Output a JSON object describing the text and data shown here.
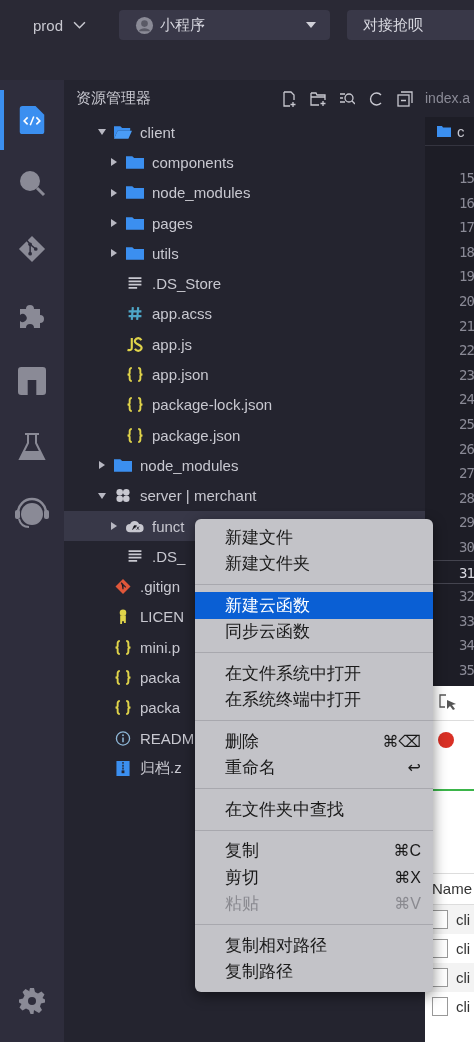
{
  "top_bar": {
    "env": "prod",
    "project": "小程序",
    "action": "对接抢呗"
  },
  "activity_bar": [
    {
      "kind": "code",
      "selected": true
    },
    {
      "kind": "search",
      "selected": false
    },
    {
      "kind": "git",
      "selected": false
    },
    {
      "kind": "extensions",
      "selected": false
    },
    {
      "kind": "store",
      "selected": false
    },
    {
      "kind": "test",
      "selected": false
    },
    {
      "kind": "support",
      "selected": false
    },
    {
      "kind": "settings",
      "selected": false
    }
  ],
  "explorer": {
    "title": "资源管理器",
    "tree": [
      {
        "name": "client",
        "kind": "folder",
        "expanded": true,
        "selected": false,
        "children": [
          {
            "name": "components",
            "kind": "folder",
            "expanded": false,
            "selected": false
          },
          {
            "name": "node_modules",
            "kind": "folder",
            "expanded": false,
            "selected": false
          },
          {
            "name": "pages",
            "kind": "folder",
            "expanded": false,
            "selected": false
          },
          {
            "name": "utils",
            "kind": "folder",
            "expanded": false,
            "selected": false
          },
          {
            "name": ".DS_Store",
            "kind": "text",
            "selected": false
          },
          {
            "name": "app.acss",
            "kind": "css",
            "selected": false
          },
          {
            "name": "app.js",
            "kind": "js",
            "selected": false
          },
          {
            "name": "app.json",
            "kind": "json",
            "selected": false
          },
          {
            "name": "package-lock.json",
            "kind": "json",
            "selected": false
          },
          {
            "name": "package.json",
            "kind": "json",
            "selected": false
          }
        ]
      },
      {
        "name": "node_modules",
        "kind": "folder",
        "expanded": false,
        "selected": false
      },
      {
        "name": "server | merchant",
        "kind": "server",
        "expanded": true,
        "selected": false,
        "children": [
          {
            "name": "funct",
            "kind": "cloud",
            "expanded": false,
            "selected": true
          },
          {
            "name": ".DS_",
            "kind": "text",
            "selected": false
          }
        ]
      },
      {
        "name": ".gitign",
        "kind": "git",
        "selected": false
      },
      {
        "name": "LICEN",
        "kind": "license",
        "selected": false
      },
      {
        "name": "mini.p",
        "kind": "json",
        "selected": false
      },
      {
        "name": "packa",
        "kind": "json",
        "selected": false
      },
      {
        "name": "packa",
        "kind": "json",
        "selected": false
      },
      {
        "name": "READM",
        "kind": "info",
        "selected": false
      },
      {
        "name": "归档.z",
        "kind": "zip",
        "selected": false
      }
    ]
  },
  "editor": {
    "tab": "index.a",
    "breadcrumb": "c",
    "lines": [
      {
        "number": "15",
        "current": false
      },
      {
        "number": "16",
        "current": false
      },
      {
        "number": "17",
        "current": false
      },
      {
        "number": "18",
        "current": false
      },
      {
        "number": "19",
        "current": false
      },
      {
        "number": "20",
        "current": false
      },
      {
        "number": "21",
        "current": false
      },
      {
        "number": "22",
        "current": false
      },
      {
        "number": "23",
        "current": false
      },
      {
        "number": "24",
        "current": false
      },
      {
        "number": "25",
        "current": false
      },
      {
        "number": "26",
        "current": false
      },
      {
        "number": "27",
        "current": false
      },
      {
        "number": "28",
        "current": false
      },
      {
        "number": "29",
        "current": false
      },
      {
        "number": "30",
        "current": false
      },
      {
        "number": "31",
        "current": true
      },
      {
        "number": "32",
        "current": false
      },
      {
        "number": "33",
        "current": false
      },
      {
        "number": "34",
        "current": false
      },
      {
        "number": "35",
        "current": false
      }
    ]
  },
  "devtools": {
    "column": "Name",
    "rows": [
      {
        "name": "cli",
        "checked": false
      },
      {
        "name": "cli",
        "checked": false
      },
      {
        "name": "cli",
        "checked": false
      },
      {
        "name": "cli",
        "checked": false
      }
    ]
  },
  "context_menu": {
    "groups": [
      {
        "items": [
          {
            "label": "新建文件",
            "selected": false,
            "disabled": false
          },
          {
            "label": "新建文件夹",
            "selected": false,
            "disabled": false
          }
        ]
      },
      {
        "items": [
          {
            "label": "新建云函数",
            "selected": true,
            "disabled": false
          },
          {
            "label": "同步云函数",
            "selected": false,
            "disabled": false
          }
        ]
      },
      {
        "items": [
          {
            "label": "在文件系统中打开",
            "selected": false,
            "disabled": false
          },
          {
            "label": "在系统终端中打开",
            "selected": false,
            "disabled": false
          }
        ]
      },
      {
        "items": [
          {
            "label": "删除",
            "shortcut": "⌘⌫",
            "selected": false,
            "disabled": false
          },
          {
            "label": "重命名",
            "shortcut": "↩",
            "selected": false,
            "disabled": false
          }
        ]
      },
      {
        "items": [
          {
            "label": "在文件夹中查找",
            "selected": false,
            "disabled": false
          }
        ]
      },
      {
        "items": [
          {
            "label": "复制",
            "shortcut": "⌘C",
            "selected": false,
            "disabled": false
          },
          {
            "label": "剪切",
            "shortcut": "⌘X",
            "selected": false,
            "disabled": false
          },
          {
            "label": "粘贴",
            "shortcut": "⌘V",
            "selected": false,
            "disabled": true
          }
        ]
      },
      {
        "items": [
          {
            "label": "复制相对路径",
            "selected": false,
            "disabled": false
          },
          {
            "label": "复制路径",
            "selected": false,
            "disabled": false
          }
        ]
      }
    ]
  }
}
